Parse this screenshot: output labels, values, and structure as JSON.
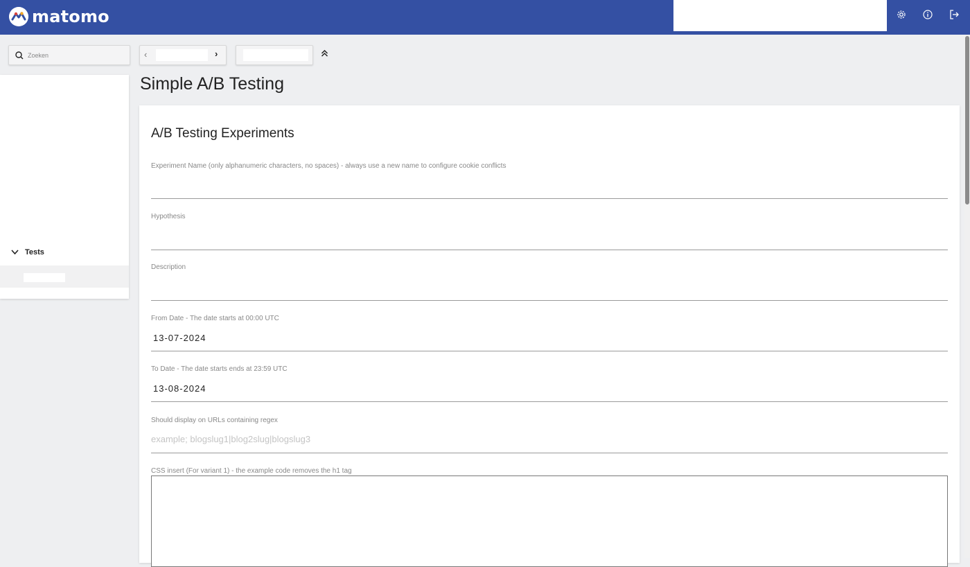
{
  "brand": {
    "name": "matomo"
  },
  "sidebar": {
    "search_placeholder": "Zoeken",
    "category": "Tests"
  },
  "header": {
    "icons": [
      "settings-icon",
      "info-icon",
      "logout-icon"
    ]
  },
  "page": {
    "title": "Simple A/B Testing"
  },
  "form": {
    "title": "A/B Testing Experiments",
    "experiment_name": {
      "label": "Experiment Name (only alphanumeric characters, no spaces) - always use a new name to configure cookie conflicts",
      "value": ""
    },
    "hypothesis": {
      "label": "Hypothesis",
      "value": ""
    },
    "description": {
      "label": "Description",
      "value": ""
    },
    "from_date": {
      "label": "From Date - The date starts at 00:00 UTC",
      "value": "13-07-2024"
    },
    "to_date": {
      "label": "To Date - The date starts ends at 23:59 UTC",
      "value": "13-08-2024"
    },
    "url_regex": {
      "label": "Should display on URLs containing regex",
      "placeholder": "example; blogslug1|blog2slug|blogslug3"
    },
    "css_insert": {
      "label": "CSS insert (For variant 1) - the example code removes the h1 tag",
      "value": ""
    }
  },
  "colors": {
    "topbar": "#3450a3",
    "background": "#eeeff1"
  }
}
